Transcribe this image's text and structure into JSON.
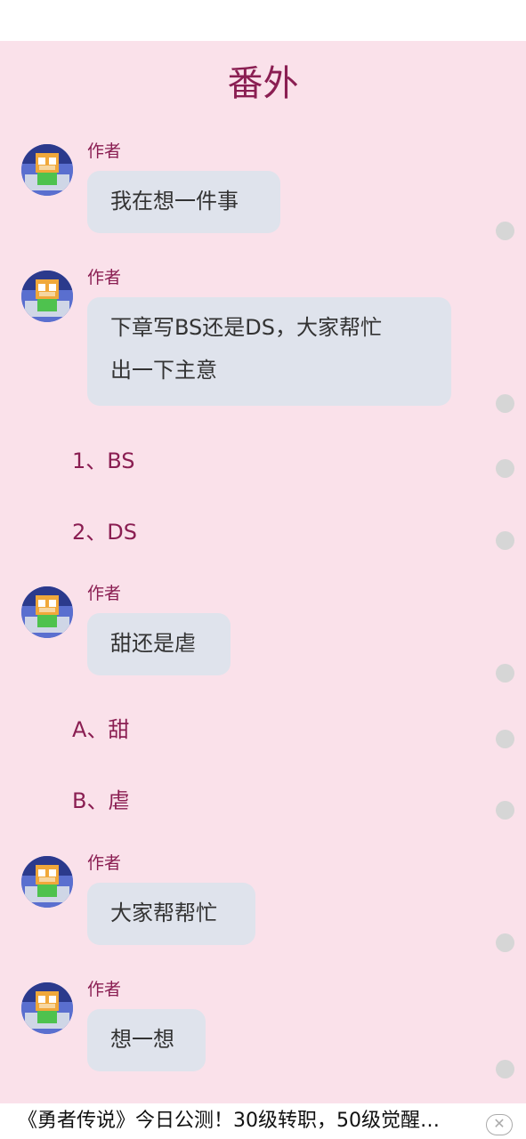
{
  "title": "番外",
  "author_label": "作者",
  "messages": [
    {
      "author": "作者",
      "text": "我在想一件事"
    },
    {
      "author": "作者",
      "text_line1": "下章写BS还是DS，大家帮忙",
      "text_line2": "出一下主意"
    },
    {
      "author": "作者",
      "text": "甜还是虐"
    },
    {
      "author": "作者",
      "text": "大家帮帮忙"
    },
    {
      "author": "作者",
      "text": "想一想"
    }
  ],
  "options": [
    "1、BS",
    "2、DS",
    "A、甜",
    "B、虐"
  ],
  "ad": {
    "text": "《勇者传说》今日公测！30级转职，50级觉醒…",
    "close_icon": "close-icon"
  },
  "colors": {
    "background": "#fae1ea",
    "accent": "#8a1e52",
    "bubble": "#dfe3ec",
    "dot": "#d6d6d6"
  }
}
